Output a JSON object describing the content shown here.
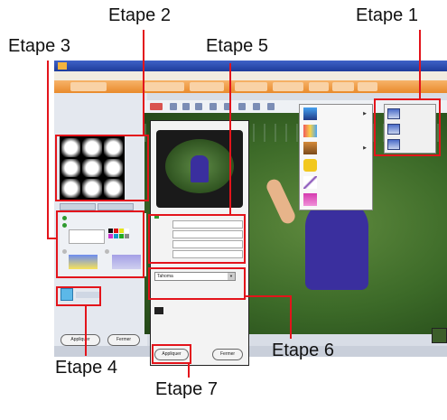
{
  "callouts": {
    "etape1": "Etape 1",
    "etape2": "Etape 2",
    "etape3": "Etape 3",
    "etape4": "Etape 4",
    "etape5": "Etape 5",
    "etape6": "Etape 6",
    "etape7": "Etape 7"
  },
  "colors": {
    "callout_red": "#e3141b",
    "title_blue": "#2a4bb0",
    "accent_orange": "#e98a2c"
  },
  "dialog": {
    "font_value": "Tahoma",
    "buttons": {
      "apply": "Appliquer",
      "close": "Fermer"
    }
  },
  "leftpanel": {
    "buttons": {
      "apply": "Appliquer",
      "close": "Fermer"
    }
  },
  "menu": {
    "items": [
      {
        "icon": "frame-icon"
      },
      {
        "icon": "color-icon"
      },
      {
        "icon": "texture-icon"
      },
      {
        "icon": "shape-icon"
      },
      {
        "icon": "signature-icon"
      },
      {
        "icon": "shadow-icon"
      }
    ],
    "submenu": [
      {
        "icon": "frame-style-1-icon"
      },
      {
        "icon": "frame-style-2-icon"
      },
      {
        "icon": "frame-style-3-icon"
      }
    ]
  }
}
